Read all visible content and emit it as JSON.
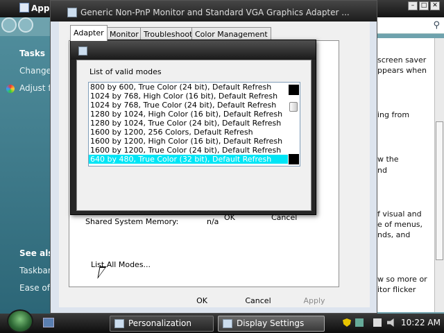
{
  "background_window": {
    "title": "App",
    "sidebar": {
      "tasks_heading": "Tasks",
      "links": [
        "Change",
        "Adjust f"
      ],
      "see_also_heading": "See also",
      "see_also_links": [
        "Taskbar",
        "Ease of"
      ]
    },
    "right_pane_text": [
      "screen saver",
      "ppears when",
      "ing from",
      "w the",
      "nd",
      "f visual and",
      "e of menus,",
      "nds, and",
      "w so more or",
      "itor flicker"
    ]
  },
  "display_settings": {
    "title": "Generic Non-PnP Monitor and Standard VGA Graphics Adapter ...",
    "tabs": [
      "Adapter",
      "Monitor",
      "Troubleshoot",
      "Color Management"
    ],
    "active_tab": "Adapter",
    "shared_memory_label": "Shared System Memory:",
    "shared_memory_value": "n/a",
    "list_all_modes_label": "List All Modes...",
    "ok_label": "OK",
    "cancel_label": "Cancel",
    "apply_label": "Apply"
  },
  "modes_dialog": {
    "label": "List of valid modes",
    "modes": [
      "800 by 600, True Color (24 bit), Default Refresh",
      "1024 by 768, High Color (16 bit), Default Refresh",
      "1024 by 768, True Color (24 bit), Default Refresh",
      "1280 by 1024, High Color (16 bit), Default Refresh",
      "1280 by 1024, True Color (24 bit), Default Refresh",
      "1600 by 1200, 256 Colors, Default Refresh",
      "1600 by 1200, High Color (16 bit), Default Refresh",
      "1600 by 1200, True Color (24 bit), Default Refresh",
      "640 by 480, True Color (32 bit), Default Refresh"
    ],
    "selected_index": 8,
    "ok_label": "OK",
    "cancel_label": "Cancel"
  },
  "taskbar": {
    "buttons": [
      "Personalization",
      "Display Settings"
    ],
    "active_button": "Display Settings",
    "clock": "10:22 AM"
  },
  "colors": {
    "selection": "#00e5f5",
    "desktop": "#0f5a6e"
  }
}
